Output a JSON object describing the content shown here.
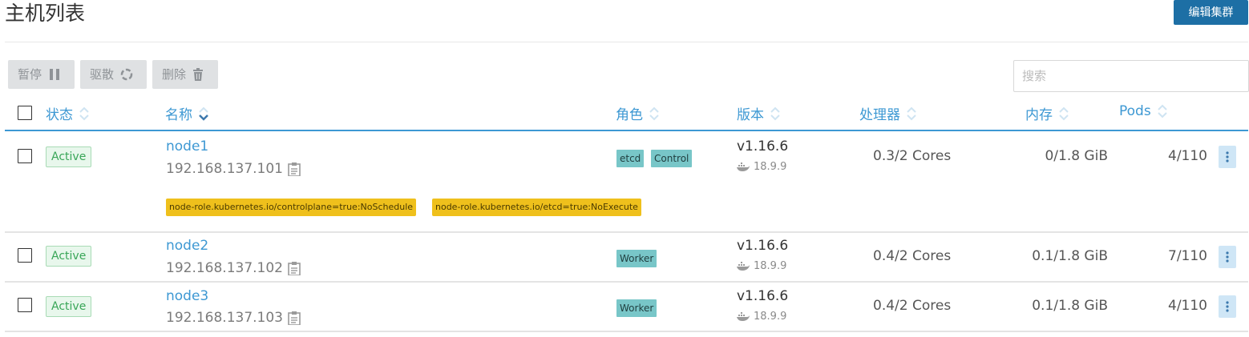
{
  "page": {
    "title": "主机列表"
  },
  "toolbar": {
    "edit_cluster_label": "编辑集群",
    "pause_label": "暂停",
    "drain_label": "驱散",
    "delete_label": "删除",
    "search_placeholder": "搜索"
  },
  "table": {
    "headers": {
      "state": "状态",
      "name": "名称",
      "roles": "角色",
      "version": "版本",
      "cpu": "处理器",
      "memory": "内存",
      "pods": "Pods"
    },
    "rows": [
      {
        "state": "Active",
        "name": "node1",
        "ip": "192.168.137.101",
        "roles": [
          "etcd",
          "Control"
        ],
        "version": "v1.16.6",
        "docker": "18.9.9",
        "cpu": "0.3/2 Cores",
        "memory": "0/1.8 GiB",
        "pods": "4/110",
        "taints": [
          "node-role.kubernetes.io/controlplane=true:NoSchedule",
          "node-role.kubernetes.io/etcd=true:NoExecute"
        ]
      },
      {
        "state": "Active",
        "name": "node2",
        "ip": "192.168.137.102",
        "roles": [
          "Worker"
        ],
        "version": "v1.16.6",
        "docker": "18.9.9",
        "cpu": "0.4/2 Cores",
        "memory": "0.1/1.8 GiB",
        "pods": "7/110"
      },
      {
        "state": "Active",
        "name": "node3",
        "ip": "192.168.137.103",
        "roles": [
          "Worker"
        ],
        "version": "v1.16.6",
        "docker": "18.9.9",
        "cpu": "0.4/2 Cores",
        "memory": "0.1/1.8 GiB",
        "pods": "4/110"
      }
    ]
  },
  "colors": {
    "accent": "#3d98d3",
    "primary_button": "#1d6fa5",
    "role_tag": "#78c6c8",
    "taint_tag": "#efc01c",
    "active_badge": "#39a658"
  },
  "icons": {
    "pause": "pause-icon",
    "drain": "refresh-icon",
    "delete": "trash-icon",
    "copy": "clipboard-icon",
    "docker": "docker-whale-icon",
    "sort": "sort-arrows-icon",
    "menu": "kebab-menu-icon"
  }
}
